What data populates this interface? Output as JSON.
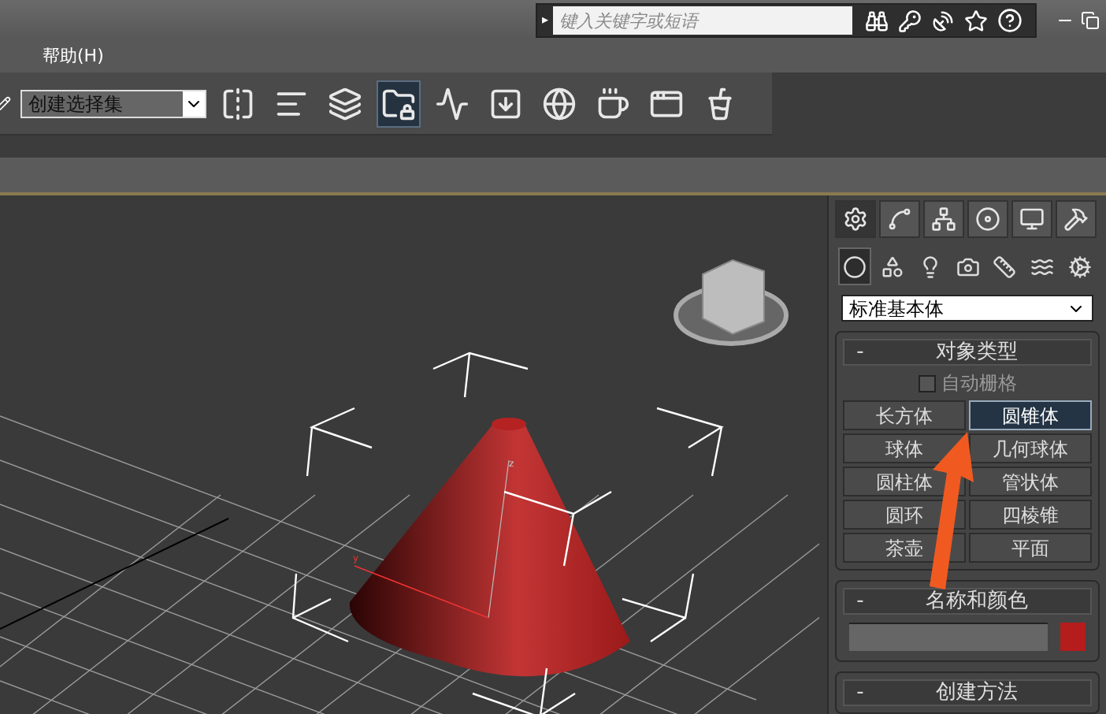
{
  "search": {
    "expander": "▸",
    "placeholder": "键入关键字或短语"
  },
  "menu": {
    "items": [
      "帮助(H)"
    ]
  },
  "toolbar": {
    "selection_set": "创建选择集",
    "tools": [
      {
        "selected": false
      },
      {
        "selected": false
      },
      {
        "selected": false
      },
      {
        "selected": true
      },
      {
        "selected": false
      },
      {
        "selected": false
      },
      {
        "selected": false
      },
      {
        "selected": false
      },
      {
        "selected": false
      },
      {
        "selected": false
      }
    ]
  },
  "viewport": {
    "axis_labels": [
      "y",
      "z"
    ]
  },
  "command_panel": {
    "tabs": [
      {
        "selected": true
      },
      {
        "selected": false
      },
      {
        "selected": false
      },
      {
        "selected": false
      },
      {
        "selected": false
      },
      {
        "selected": false
      }
    ],
    "subtypes": [
      {
        "selected": true
      },
      {
        "selected": false
      },
      {
        "selected": false
      },
      {
        "selected": false
      },
      {
        "selected": false
      },
      {
        "selected": false
      },
      {
        "selected": false
      }
    ],
    "category": "标准基本体",
    "object_type": {
      "marker": "-",
      "title": "对象类型",
      "autogrid": {
        "label": "自动栅格",
        "checked": false
      },
      "objects": [
        {
          "label": "长方体",
          "selected": false
        },
        {
          "label": "圆锥体",
          "selected": true
        },
        {
          "label": "球体",
          "selected": false
        },
        {
          "label": "几何球体",
          "selected": false
        },
        {
          "label": "圆柱体",
          "selected": false
        },
        {
          "label": "管状体",
          "selected": false
        },
        {
          "label": "圆环",
          "selected": false
        },
        {
          "label": "四棱锥",
          "selected": false
        },
        {
          "label": "茶壶",
          "selected": false
        },
        {
          "label": "平面",
          "selected": false
        }
      ]
    },
    "name_color": {
      "marker": "-",
      "title": "名称和颜色",
      "color": "#b51c1c"
    },
    "creation_method": {
      "marker": "-",
      "title": "创建方法"
    }
  }
}
